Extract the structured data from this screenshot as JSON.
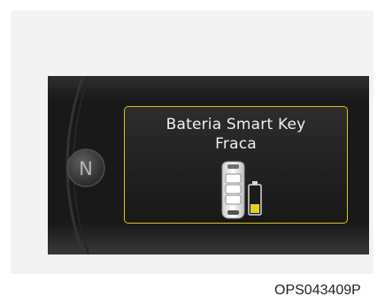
{
  "message": {
    "line1": "Bateria Smart Key",
    "line2": "Fraca"
  },
  "gear_indicator": "N",
  "battery_level": 0.2,
  "colors": {
    "border_accent": "#d9c21f",
    "battery_fill": "#e2cf2b",
    "display_background": "#191919",
    "text": "#efefef"
  },
  "icons": [
    "smart-key-fob-icon",
    "low-battery-icon",
    "gear-dial-icon"
  ],
  "figure_code": "OPS043409P"
}
